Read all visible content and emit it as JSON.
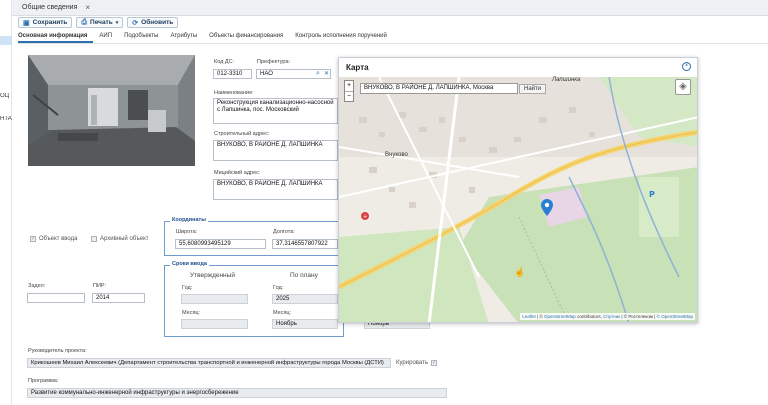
{
  "left_nav": {
    "items": [
      "ОЦ",
      "НТА"
    ]
  },
  "window": {
    "tab_title": "Общие сведения"
  },
  "toolbar": {
    "save": "Сохранить",
    "print": "Печать",
    "refresh": "Обновить"
  },
  "tabs": [
    "Основная информация",
    "АИП",
    "Подобъекты",
    "Атрибуты",
    "Объекты финансирования",
    "Контроль исполнения поручений"
  ],
  "form": {
    "kod_label": "Код ДС:",
    "kod_value": "012-3310",
    "pref_label": "Префектура:",
    "pref_value": "НАО",
    "name_label": "Наименование:",
    "name_value": "Реконструкция канализационно-насосной с Лапшинка, пос. Московский",
    "build_addr_label": "Строительный адрес:",
    "build_addr_value": "ВНУКОВО, В РАЙОНЕ Д. ЛАПШИНКА",
    "muni_addr_label": "Мицийский адрес:",
    "muni_addr_value": "ВНУКОВО, В РАЙОНЕ Д. ЛАПШИНКА",
    "object_input": "Объект ввода",
    "archive": "Архивный объект",
    "coords_title": "Координаты",
    "lat_label": "Широта:",
    "lat_value": "55,6080993495129",
    "lon_label": "Долгота:",
    "lon_value": "37,3146557807922",
    "terms_title": "Сроки ввода",
    "approved": "Утвержденный",
    "plan": "По плану",
    "year_label": "Год:",
    "month_label": "Месяц:",
    "plan_year": "2025",
    "plan_month": "Ноябрь",
    "fact_month": "Ноябрь",
    "zadel_label": "Задел:",
    "zadel_value": "",
    "pir_label": "ПИР:",
    "pir_value": "2014",
    "leader_label": "Руководитель проекта:",
    "leader_value": "Крикошеев Михаил Алексеевич (Департамент строительства транспортной и инженерной инфраструктуры города Москвы (ДСТИ)",
    "curator": "Курировать",
    "program_label": "Программа:",
    "program_value": "Развитие коммунально-инженерной инфраструктуры и энергосбережение"
  },
  "map": {
    "title": "Карта",
    "search_value": "ВНУКОВО, В РАЙОНЕ Д. ЛАПШИНКА, Москва",
    "find_button": "Найти",
    "zoom_in": "+",
    "zoom_out": "−",
    "labels": {
      "town": "Внуково",
      "lapshinka": "Лапшинка"
    },
    "attrib": {
      "leaflet": "Leaflet",
      "osm": "OpenStreetMap",
      "contrib": "contributors,",
      "sputnik": "Спутник",
      "rosr": "© Ростелеком",
      "osm2": "© OpenStreetMap"
    },
    "colors": {
      "park": "#c8e1b7",
      "residential": "#e5e1da",
      "pin": "#2a7fd1"
    }
  }
}
